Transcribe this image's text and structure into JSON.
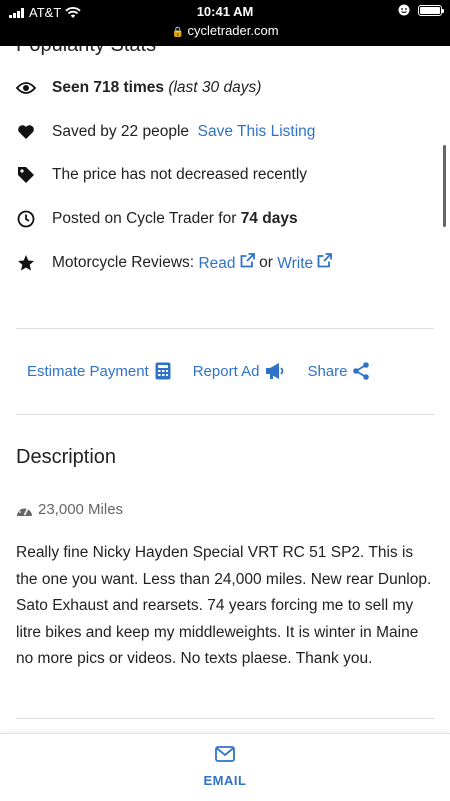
{
  "status_bar": {
    "carrier": "AT&T",
    "time": "10:41 AM",
    "url": "cycletrader.com"
  },
  "popularity": {
    "title": "Popularity Stats",
    "seen": {
      "bold": "Seen 718 times",
      "italic": "(last 30 days)"
    },
    "saved": {
      "text": "Saved by 22 people",
      "link": "Save This Listing"
    },
    "price": {
      "text": "The price has not decreased recently"
    },
    "posted": {
      "text": "Posted on Cycle Trader for",
      "bold": "74 days"
    },
    "reviews": {
      "text": "Motorcycle Reviews:",
      "read": "Read",
      "or": "or",
      "write": "Write"
    }
  },
  "actions": {
    "estimate": "Estimate Payment",
    "report": "Report Ad",
    "share": "Share"
  },
  "description": {
    "title": "Description",
    "miles": "23,000 Miles",
    "text": "Really fine Nicky Hayden Special VRT RC 51 SP2. This is the one you want. Less than 24,000 miles. New rear Dunlop. Sato Exhaust and rearsets. 74 years forcing me to sell my litre bikes and keep my middleweights. It is winter in Maine no more pics or videos. No texts plaese. Thank you."
  },
  "bottom_bar": {
    "email_label": "EMAIL"
  },
  "colors": {
    "link": "#2f73c9",
    "status_bar_bg": "#000000"
  }
}
